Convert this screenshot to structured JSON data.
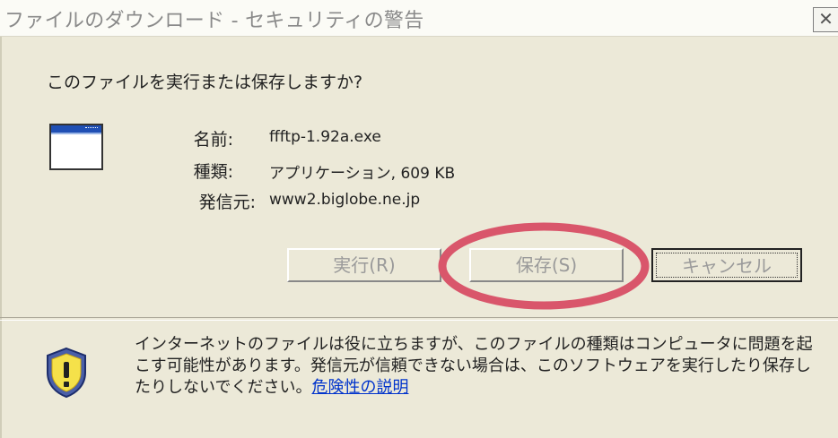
{
  "window": {
    "title": "ファイルのダウンロード - セキュリティの警告",
    "close_glyph": "✕"
  },
  "prompt": {
    "question": "このファイルを実行または保存しますか?"
  },
  "file_info": {
    "name_label": "名前:",
    "name_value": "ffftp-1.92a.exe",
    "type_label": "種類:",
    "type_value": "アプリケーション, 609 KB",
    "from_label": "発信元:",
    "from_value": "www2.biglobe.ne.jp"
  },
  "buttons": {
    "run": "実行(R)",
    "save": "保存(S)",
    "cancel": "キャンセル"
  },
  "warning": {
    "text": "インターネットのファイルは役に立ちますが、このファイルの種類はコンピュータに問題を起こす可能性があります。発信元が信頼できない場合は、このソフトウェアを実行したり保存したりしないでください。",
    "link": "危険性の説明"
  },
  "icons": {
    "app": "application-window-icon",
    "warning": "security-shield-icon"
  },
  "colors": {
    "dialog_bg": "#ece9d8",
    "highlight": "#d9566b",
    "link": "#0033cc"
  }
}
